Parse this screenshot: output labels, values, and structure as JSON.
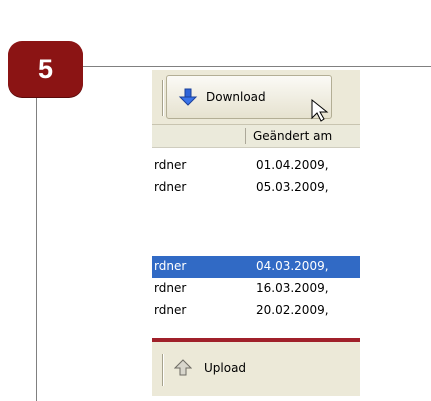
{
  "step_badge": {
    "number": "5",
    "color": "#8b1414"
  },
  "toolbar": {
    "download_label": "Download",
    "download_icon": "arrow-down-icon"
  },
  "columns": {
    "modified_header": "Geändert am"
  },
  "files": [
    {
      "type": "rdner",
      "modified": "01.04.2009, ",
      "selected": false
    },
    {
      "type": "rdner",
      "modified": "05.03.2009,",
      "selected": false
    },
    {
      "type": "rdner",
      "modified": "04.03.2009,",
      "selected": true
    },
    {
      "type": "rdner",
      "modified": "16.03.2009, ",
      "selected": false
    },
    {
      "type": "rdner",
      "modified": "20.02.2009,",
      "selected": false
    }
  ],
  "upload_toolbar": {
    "upload_label": "Upload",
    "upload_icon": "arrow-up-icon"
  },
  "colors": {
    "selection": "#316ac5",
    "accent_bar": "#a0202a",
    "toolbar_bg": "#ece9d8"
  }
}
